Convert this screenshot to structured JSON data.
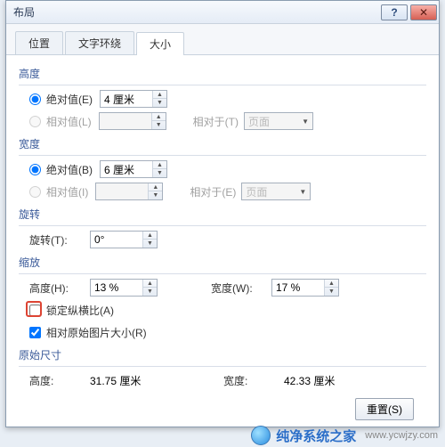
{
  "window_title": "布局",
  "tabs": {
    "t0": "位置",
    "t1": "文字环绕",
    "t2": "大小"
  },
  "height": {
    "group": "高度",
    "abs_label": "绝对值(E)",
    "abs_value": "4 厘米",
    "rel_label": "相对值(L)",
    "rel_to_label": "相对于(T)",
    "rel_to_value": "页面"
  },
  "width": {
    "group": "宽度",
    "abs_label": "绝对值(B)",
    "abs_value": "6 厘米",
    "rel_label": "相对值(I)",
    "rel_to_label": "相对于(E)",
    "rel_to_value": "页面"
  },
  "rotate": {
    "group": "旋转",
    "label": "旋转(T):",
    "value": "0°"
  },
  "scale": {
    "group": "缩放",
    "h_label": "高度(H):",
    "h_value": "13 %",
    "w_label": "宽度(W):",
    "w_value": "17 %",
    "lock_label": "锁定纵横比(A)",
    "orig_label": "相对原始图片大小(R)"
  },
  "original": {
    "group": "原始尺寸",
    "h_label": "高度:",
    "h_value": "31.75 厘米",
    "w_label": "宽度:",
    "w_value": "42.33 厘米"
  },
  "reset_btn": "重置(S)",
  "watermark": {
    "name": "纯净系统之家",
    "url": "www.ycwjzy.com"
  }
}
